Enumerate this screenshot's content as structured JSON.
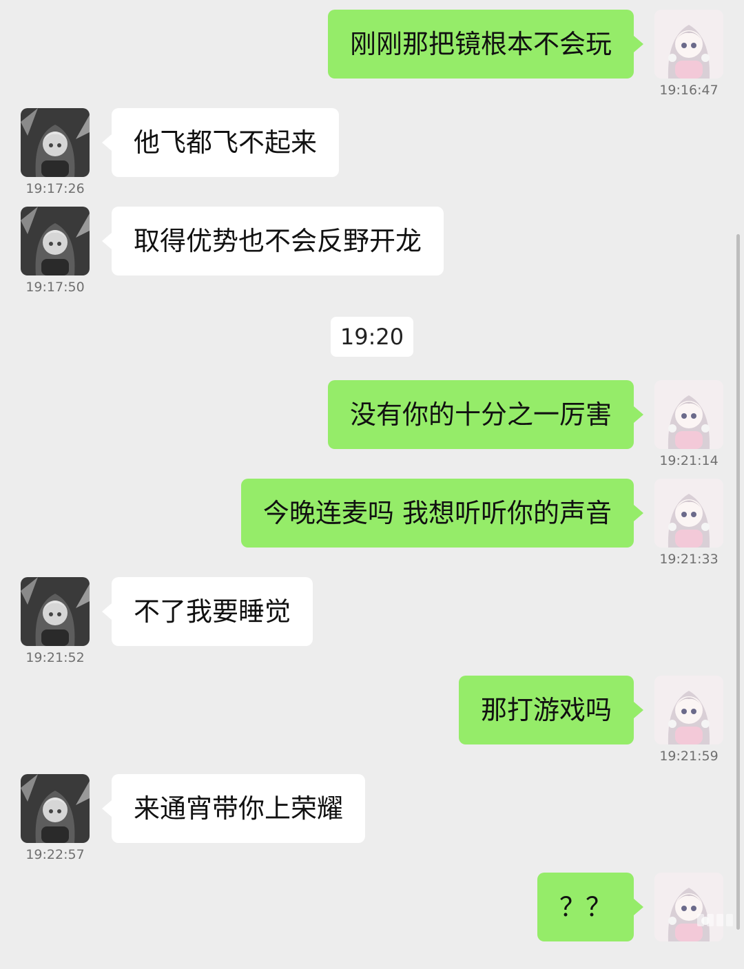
{
  "divider_time": "19:20",
  "messages": [
    {
      "side": "out",
      "text": "刚刚那把镜根本不会玩",
      "time": "19:16:47"
    },
    {
      "side": "in",
      "text": "他飞都飞不起来",
      "time": "19:17:26"
    },
    {
      "side": "in",
      "text": "取得优势也不会反野开龙",
      "time": "19:17:50"
    },
    {
      "side": "out",
      "text": "没有你的十分之一厉害",
      "time": "19:21:14"
    },
    {
      "side": "out",
      "text": "今晚连麦吗 我想听听你的声音",
      "time": "19:21:33"
    },
    {
      "side": "in",
      "text": "不了我要睡觉",
      "time": "19:21:52"
    },
    {
      "side": "out",
      "text": "那打游戏吗",
      "time": "19:21:59"
    },
    {
      "side": "in",
      "text": "来通宵带你上荣耀",
      "time": "19:22:57"
    },
    {
      "side": "out",
      "text": "？？",
      "time": ""
    }
  ],
  "colors": {
    "background": "#ededed",
    "outgoing_bubble": "#95ec69",
    "incoming_bubble": "#ffffff"
  },
  "icons": {
    "self_avatar": "anime-girl-pink-avatar",
    "contact_avatar": "anime-girl-gray-avatar"
  }
}
